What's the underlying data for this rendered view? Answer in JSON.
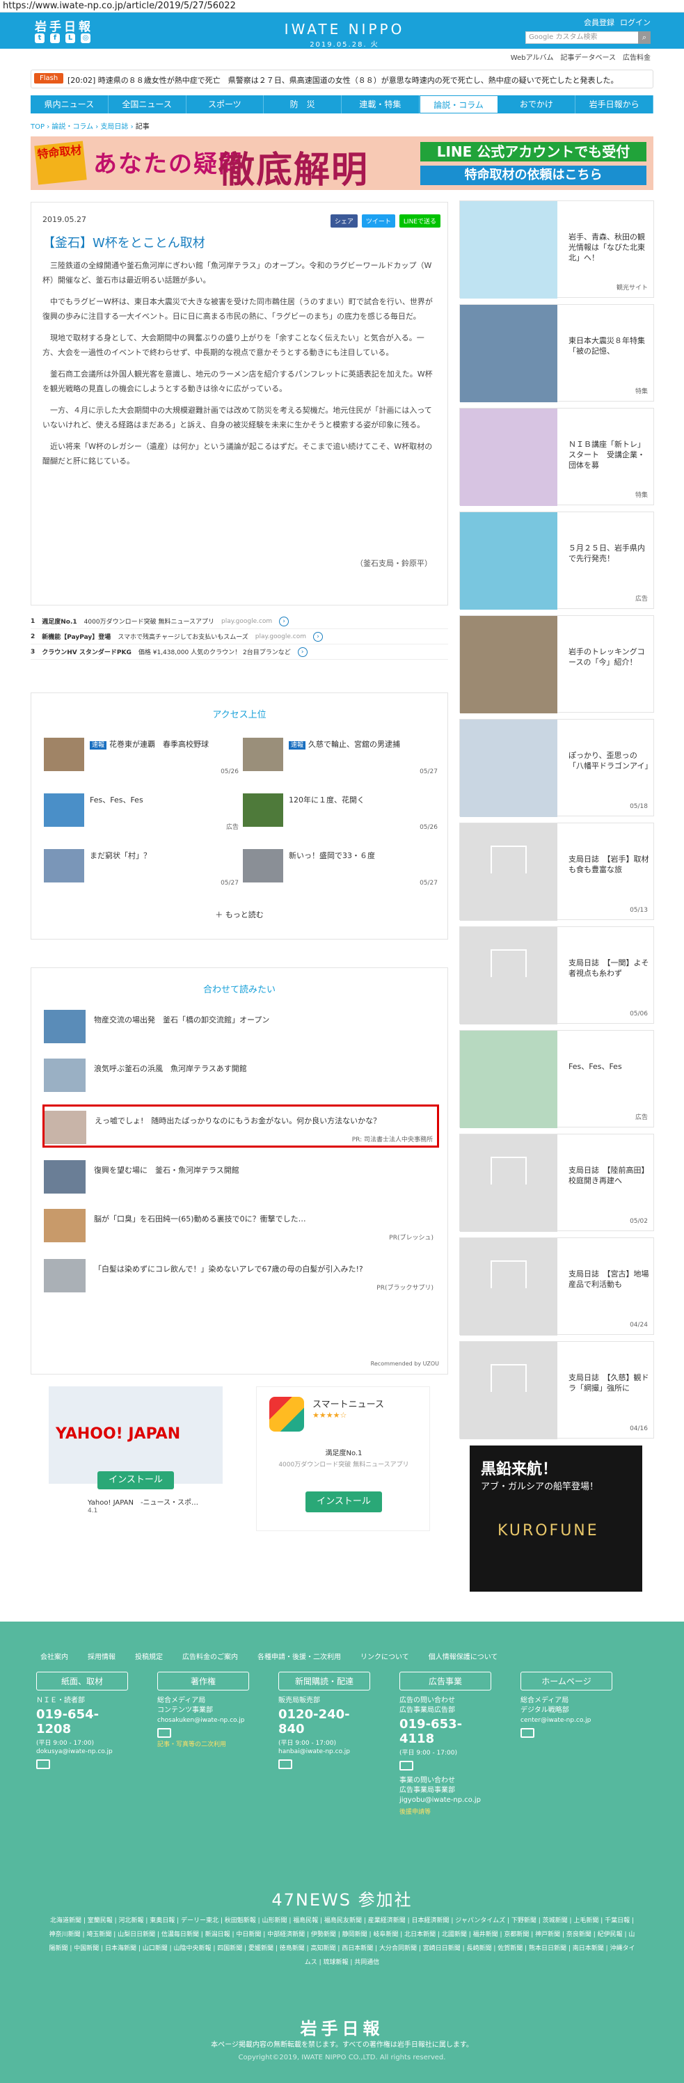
{
  "url": "https://www.iwate-np.co.jp/article/2019/5/27/56022",
  "header": {
    "logo": "岩手日報",
    "brand": "IWATE NIPPO",
    "date": "2019.05.28. 火",
    "links": [
      "会員登録",
      "ログイン"
    ],
    "search_placeholder": "Google カスタム検索",
    "sub_links": [
      "Webアルバム",
      "記事データベース",
      "広告料金"
    ]
  },
  "flash": {
    "tag": "Flash",
    "text": "[20:02] 時速県の８８歳女性が熱中症で死亡　県警察は２７日、県高速国道の女性（８８）が意思な時速内の死で死亡し、熱中症の疑いで死亡したと発表した。"
  },
  "nav": [
    "県内ニュース",
    "全国ニュース",
    "スポーツ",
    "防　災",
    "連載・特集",
    "論説・コラム",
    "おでかけ",
    "岩手日報から"
  ],
  "breadcrumb": [
    "TOP",
    "論説・コラム",
    "支局日誌",
    "記事"
  ],
  "banner": {
    "tag": "特命取材",
    "main": "あなたの疑問",
    "big": "徹底解明",
    "line1": "LINE 公式アカウントでも受付",
    "line2": "特命取材の依頼はこちら"
  },
  "article": {
    "date": "2019.05.27",
    "title": "【釜石】W杯をとことん取材",
    "share": [
      "シェア",
      "ツイート",
      "LINEで送る"
    ],
    "paragraphs": [
      "三陸鉄道の全線開通や釜石魚河岸にぎわい館「魚河岸テラス」のオープン。令和のラグビーワールドカップ（W杯）開催など、釜石市は最近明るい話題が多い。",
      "中でもラグビーW杯は、東日本大震災で大きな被害を受けた同市鵜住居（うのすまい）町で試合を行い、世界が復興の歩みに注目する一大イベント。日に日に高まる市民の熱に、「ラグビーのまち」の底力を感じる毎日だ。",
      "現地で取材する身として、大会期間中の興奮ぶりの盛り上がりを「余すことなく伝えたい」と気合が入る。一方、大会を一過性のイベントで終わらせず、中長期的な視点で意かそうとする動きにも注目している。",
      "釜石商工会議所は外国人観光客を意識し、地元のラーメン店を紹介するパンフレットに英語表記を加えた。W杯を観光戦略の見直しの機会にしようとする動きは徐々に広がっている。",
      "一方、４月に示した大会期間中の大規模避難計画では改めて防災を考える契機だ。地元住民が「計画には入っていないけれど、使える経路はまだある」と訴え、自身の被災経験を未来に生かそうと模索する姿が印象に残る。",
      "近い将来「W杯のレガシー（遺産）は何か」という議論が起こるはずだ。そこまで追い続けてこそ、W杯取材の醍醐だと肝に銘じている。"
    ],
    "byline": "（釜石支局・鈴原平）"
  },
  "ads": [
    {
      "rank": "1",
      "name": "週足度No.1",
      "desc": "4000万ダウンロード突破 無料ニュースアプリ",
      "src": "play.google.com"
    },
    {
      "rank": "2",
      "name": "新機能【PayPay】登場",
      "desc": "スマホで残高チャージしてお支払いもスムーズ",
      "src": "play.google.com"
    },
    {
      "rank": "3",
      "name": "クラウンHV スタンダードPKG",
      "desc": "価格 ¥1,438,000 人気のクラウン！ 2台目プランなど",
      "src": ""
    }
  ],
  "access": {
    "title": "アクセス上位",
    "items": [
      {
        "title": "花巻東が連覇　春季高校野球",
        "badge": "速報",
        "date": "05/26"
      },
      {
        "title": "久慈で輪止、宮舘の男逮捕",
        "badge": "速報",
        "date": "05/27"
      },
      {
        "title": "Fes、Fes、Fes",
        "badge": "",
        "date": "広告"
      },
      {
        "title": "120年に１度、花開く",
        "badge": "",
        "date": "05/26"
      },
      {
        "title": "まだ窮状「村」？",
        "badge": "",
        "date": "05/27"
      },
      {
        "title": "新いっ！盛岡で33・６度",
        "badge": "",
        "date": "05/27"
      }
    ],
    "more": "もっと読む"
  },
  "related": {
    "title": "合わせて読みたい",
    "items": [
      {
        "title": "物産交流の場出発　釜石「橋の卸交流館」オープン",
        "pr": ""
      },
      {
        "title": "浪気呼ぶ釜石の浜風　魚河岸テラスあす開館",
        "pr": ""
      },
      {
        "title": "えっ嘘でしょ!　随時出たばっかりなのにもうお金がない。何か良い方法ないかな？",
        "pr": "PR: 司法書士法人中央事務所"
      },
      {
        "title": "復興を望む場に　釜石・魚河岸テラス開館",
        "pr": ""
      },
      {
        "title": "脳が「口臭」を石田純一(65)動める裏技で0に？衝撃でした…",
        "pr": "PR(ブレッシュ)"
      },
      {
        "title": "「白髪は染めずにコレ飲んで！」染めないアレで67歳の母の白髪が引入みた!?",
        "pr": "PR(ブラックサプリ)"
      }
    ],
    "footer": "Recommended by UZOU"
  },
  "promo_yahoo": {
    "app": "Yahoo! JAPAN　-ニュース・スポ…",
    "rating": "4.1",
    "button": "インストール"
  },
  "promo_smart": {
    "app": "スマートニュース",
    "desc": "満足度No.1",
    "sub": "4000万ダウンロード突破 無料ニュースアプリ",
    "button": "インストール"
  },
  "sidebar": [
    {
      "text": "岩手、青森、秋田の観光情報は「なびた北東北」へ！",
      "label": "観光サイト"
    },
    {
      "text": "東日本大震災８年特集「被の記憶、",
      "label": "特集"
    },
    {
      "text": "ＮＩＢ講座「新トレ」スタート　受講企業・団体を募",
      "label": "特集"
    },
    {
      "text": "５月２５日、岩手県内で先行発売！",
      "label": "広告"
    },
    {
      "text": "岩手のトレッキングコースの「今」紹介！",
      "label": ""
    },
    {
      "text": "ぽっかり、歪思っの「八幡平ドラゴンアイ」",
      "label": "05/18"
    },
    {
      "text": "支局日誌　【岩手】取材も食も豊富な旅",
      "label": "05/13"
    },
    {
      "text": "支局日誌　【一関】よそ者視点も糸わず",
      "label": "05/06"
    },
    {
      "text": "Fes、Fes、Fes",
      "label": "広告"
    },
    {
      "text": "支局日誌　【陸前高田】校庭開き再建へ",
      "label": "05/02"
    },
    {
      "text": "支局日誌　【宮古】地場産品で利活動も",
      "label": "04/24"
    },
    {
      "text": "支局日誌　【久慈】観ドラ「網撮」強所に",
      "label": "04/16"
    }
  ],
  "side_ad": {
    "title": "黒鉛来航！",
    "sub": "アブ・ガルシアの船竿登場！",
    "brand": "KUROFUNE"
  },
  "footer": {
    "links": [
      "会社案内",
      "採用情報",
      "投稿規定",
      "広告料金のご案内",
      "各種申請・後援・二次利用",
      "リンクについて",
      "個人情報保護について"
    ],
    "cols": [
      {
        "head": "紙面、取材",
        "s": "ＮＩＥ・読者部",
        "phone": "019-654-1208",
        "hours": "(平日 9:00 - 17:00)",
        "mail": "dokusya@iwate-np.co.jp"
      },
      {
        "head": "著作権",
        "s": "総合メディア局\nコンテンツ事業部",
        "phone": "",
        "hours": "",
        "mail": "chosakuken@iwate-np.co.jp",
        "extra": "記事・写真等の二次利用"
      },
      {
        "head": "新聞購読・配達",
        "s": "販売局販売部",
        "phone": "0120-240-840",
        "hours": "(平日 9:00 - 17:00)",
        "mail": "hanbai@iwate-np.co.jp"
      },
      {
        "head": "広告事業",
        "s": "広告の問い合わせ\n広告事業局広告部",
        "phone": "019-653-4118",
        "hours": "(平日 9:00 - 17:00)",
        "mail": "",
        "extra2": "事業の問い合わせ\n広告事業局事業部\njigyobu@iwate-np.co.jp",
        "extra": "後援申請等"
      },
      {
        "head": "ホームページ",
        "s": "総合メディア局\nデジタル戦略部",
        "phone": "",
        "hours": "",
        "mail": "center@iwate-np.co.jp"
      }
    ],
    "n47": "47NEWS 参加社",
    "papers": "北海道新聞 | 室蘭民報 | 河北新報 | 東奥日報 | デーリー東北 | 秋田魁新報 | 山形新聞 | 福島民報 | 福島民友新聞 | 産業経済新聞 | 日本経済新聞 | ジャパンタイムズ | 下野新聞 | 茨城新聞 | 上毛新聞 | 千葉日報 | 神奈川新聞 | 埼玉新聞 | 山梨日日新聞 | 信濃毎日新聞 | 新潟日報 | 中日新聞 | 中部経済新聞 | 伊勢新聞 | 静岡新聞 | 岐阜新聞 | 北日本新聞 | 北國新聞 | 福井新聞 | 京都新聞 | 神戸新聞 | 奈良新聞 | 紀伊民報 | 山陽新聞 | 中国新聞 | 日本海新聞 | 山口新聞 | 山陰中央新報 | 四国新聞 | 愛媛新聞 | 徳島新聞 | 高知新聞 | 西日本新聞 | 大分合同新聞 | 宮崎日日新聞 | 長崎新聞 | 佐賀新聞 | 熊本日日新聞 | 南日本新聞 | 沖縄タイムス | 琉球新報 | 共同通信",
    "logo": "岩手日報",
    "copy1": "本ページ掲載内容の無断転載を禁じます。すべての著作権は岩手日報社に属します。",
    "copy2": "Copyright©2019, IWATE NIPPO CO.,LTD. All rights reserved."
  }
}
